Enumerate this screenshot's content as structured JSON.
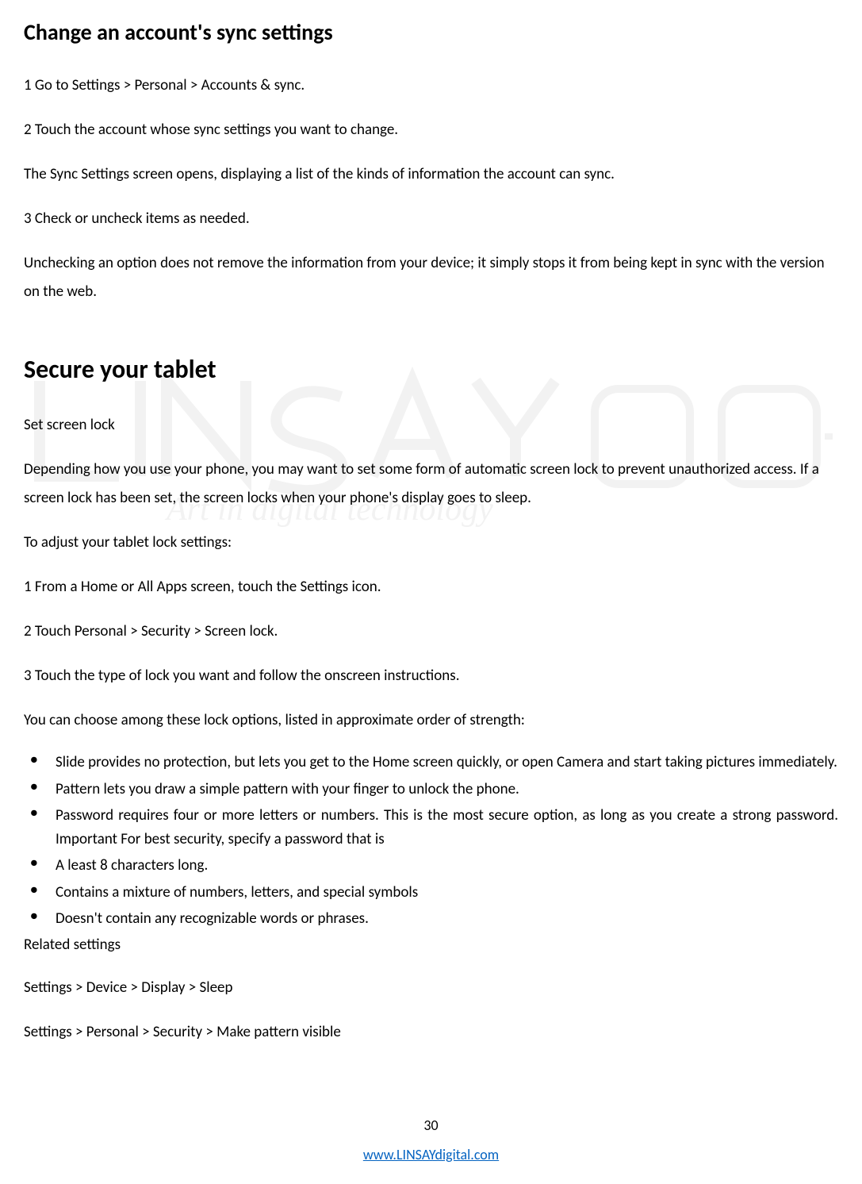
{
  "section1": {
    "heading": "Change an account's sync settings",
    "p1": "1 Go to Settings > Personal > Accounts & sync.",
    "p2": "2 Touch the account whose sync settings you want to change.",
    "p3": "The Sync Settings screen opens, displaying a list of the kinds of information the account can sync.",
    "p4": "3 Check or uncheck items as needed.",
    "p5": "Unchecking an option does not remove the information from your device; it simply stops it from being kept in sync with the version on the web."
  },
  "section2": {
    "heading": "Secure your tablet",
    "p1": "Set screen lock",
    "p2": "Depending how you use your phone, you may want to set some form of automatic screen lock to prevent unauthorized access. If a screen lock has been set, the screen locks when your phone's display goes to sleep.",
    "p3": "To adjust your tablet lock settings:",
    "p4": "1 From a Home or All Apps screen, touch the Settings icon.",
    "p5": "2 Touch Personal > Security > Screen lock.",
    "p6": "3 Touch the type of lock you want and follow the onscreen instructions.",
    "p7": "You can choose among these lock options, listed in approximate order of strength:",
    "bullets": [
      "Slide provides no protection, but lets you get to the Home screen quickly, or open Camera and start taking pictures immediately.",
      "Pattern lets you draw a simple pattern with your finger to unlock the phone.",
      "Password requires four or more letters or numbers. This is the most secure option, as long as you create a strong password. Important For best security, specify a password that is",
      "A least 8 characters long.",
      "Contains a mixture of numbers, letters, and special symbols",
      "Doesn't contain any recognizable words or phrases."
    ],
    "p8": "Related settings",
    "p9": "Settings > Device > Display > Sleep",
    "p10": "Settings > Personal > Security > Make pattern visible"
  },
  "footer": {
    "pageNumber": "30",
    "link": "www.LINSAYdigital.com"
  },
  "watermark": {
    "tagline": "Art in digital technology"
  }
}
